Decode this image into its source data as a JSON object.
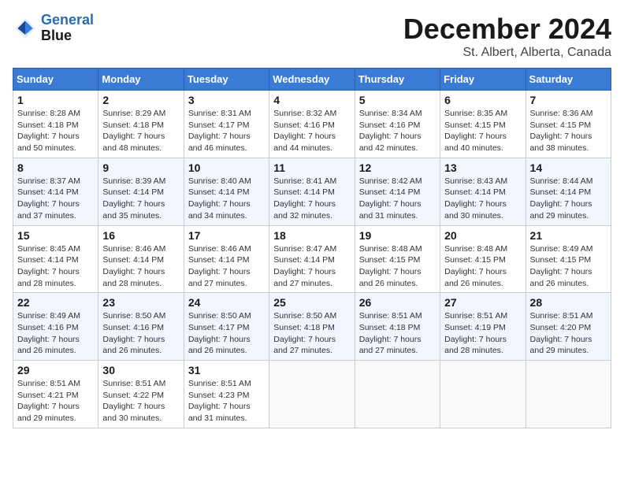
{
  "header": {
    "logo_line1": "General",
    "logo_line2": "Blue",
    "title": "December 2024",
    "subtitle": "St. Albert, Alberta, Canada"
  },
  "days_of_week": [
    "Sunday",
    "Monday",
    "Tuesday",
    "Wednesday",
    "Thursday",
    "Friday",
    "Saturday"
  ],
  "weeks": [
    [
      {
        "day": "1",
        "sunrise": "Sunrise: 8:28 AM",
        "sunset": "Sunset: 4:18 PM",
        "daylight": "Daylight: 7 hours and 50 minutes."
      },
      {
        "day": "2",
        "sunrise": "Sunrise: 8:29 AM",
        "sunset": "Sunset: 4:18 PM",
        "daylight": "Daylight: 7 hours and 48 minutes."
      },
      {
        "day": "3",
        "sunrise": "Sunrise: 8:31 AM",
        "sunset": "Sunset: 4:17 PM",
        "daylight": "Daylight: 7 hours and 46 minutes."
      },
      {
        "day": "4",
        "sunrise": "Sunrise: 8:32 AM",
        "sunset": "Sunset: 4:16 PM",
        "daylight": "Daylight: 7 hours and 44 minutes."
      },
      {
        "day": "5",
        "sunrise": "Sunrise: 8:34 AM",
        "sunset": "Sunset: 4:16 PM",
        "daylight": "Daylight: 7 hours and 42 minutes."
      },
      {
        "day": "6",
        "sunrise": "Sunrise: 8:35 AM",
        "sunset": "Sunset: 4:15 PM",
        "daylight": "Daylight: 7 hours and 40 minutes."
      },
      {
        "day": "7",
        "sunrise": "Sunrise: 8:36 AM",
        "sunset": "Sunset: 4:15 PM",
        "daylight": "Daylight: 7 hours and 38 minutes."
      }
    ],
    [
      {
        "day": "8",
        "sunrise": "Sunrise: 8:37 AM",
        "sunset": "Sunset: 4:14 PM",
        "daylight": "Daylight: 7 hours and 37 minutes."
      },
      {
        "day": "9",
        "sunrise": "Sunrise: 8:39 AM",
        "sunset": "Sunset: 4:14 PM",
        "daylight": "Daylight: 7 hours and 35 minutes."
      },
      {
        "day": "10",
        "sunrise": "Sunrise: 8:40 AM",
        "sunset": "Sunset: 4:14 PM",
        "daylight": "Daylight: 7 hours and 34 minutes."
      },
      {
        "day": "11",
        "sunrise": "Sunrise: 8:41 AM",
        "sunset": "Sunset: 4:14 PM",
        "daylight": "Daylight: 7 hours and 32 minutes."
      },
      {
        "day": "12",
        "sunrise": "Sunrise: 8:42 AM",
        "sunset": "Sunset: 4:14 PM",
        "daylight": "Daylight: 7 hours and 31 minutes."
      },
      {
        "day": "13",
        "sunrise": "Sunrise: 8:43 AM",
        "sunset": "Sunset: 4:14 PM",
        "daylight": "Daylight: 7 hours and 30 minutes."
      },
      {
        "day": "14",
        "sunrise": "Sunrise: 8:44 AM",
        "sunset": "Sunset: 4:14 PM",
        "daylight": "Daylight: 7 hours and 29 minutes."
      }
    ],
    [
      {
        "day": "15",
        "sunrise": "Sunrise: 8:45 AM",
        "sunset": "Sunset: 4:14 PM",
        "daylight": "Daylight: 7 hours and 28 minutes."
      },
      {
        "day": "16",
        "sunrise": "Sunrise: 8:46 AM",
        "sunset": "Sunset: 4:14 PM",
        "daylight": "Daylight: 7 hours and 28 minutes."
      },
      {
        "day": "17",
        "sunrise": "Sunrise: 8:46 AM",
        "sunset": "Sunset: 4:14 PM",
        "daylight": "Daylight: 7 hours and 27 minutes."
      },
      {
        "day": "18",
        "sunrise": "Sunrise: 8:47 AM",
        "sunset": "Sunset: 4:14 PM",
        "daylight": "Daylight: 7 hours and 27 minutes."
      },
      {
        "day": "19",
        "sunrise": "Sunrise: 8:48 AM",
        "sunset": "Sunset: 4:15 PM",
        "daylight": "Daylight: 7 hours and 26 minutes."
      },
      {
        "day": "20",
        "sunrise": "Sunrise: 8:48 AM",
        "sunset": "Sunset: 4:15 PM",
        "daylight": "Daylight: 7 hours and 26 minutes."
      },
      {
        "day": "21",
        "sunrise": "Sunrise: 8:49 AM",
        "sunset": "Sunset: 4:15 PM",
        "daylight": "Daylight: 7 hours and 26 minutes."
      }
    ],
    [
      {
        "day": "22",
        "sunrise": "Sunrise: 8:49 AM",
        "sunset": "Sunset: 4:16 PM",
        "daylight": "Daylight: 7 hours and 26 minutes."
      },
      {
        "day": "23",
        "sunrise": "Sunrise: 8:50 AM",
        "sunset": "Sunset: 4:16 PM",
        "daylight": "Daylight: 7 hours and 26 minutes."
      },
      {
        "day": "24",
        "sunrise": "Sunrise: 8:50 AM",
        "sunset": "Sunset: 4:17 PM",
        "daylight": "Daylight: 7 hours and 26 minutes."
      },
      {
        "day": "25",
        "sunrise": "Sunrise: 8:50 AM",
        "sunset": "Sunset: 4:18 PM",
        "daylight": "Daylight: 7 hours and 27 minutes."
      },
      {
        "day": "26",
        "sunrise": "Sunrise: 8:51 AM",
        "sunset": "Sunset: 4:18 PM",
        "daylight": "Daylight: 7 hours and 27 minutes."
      },
      {
        "day": "27",
        "sunrise": "Sunrise: 8:51 AM",
        "sunset": "Sunset: 4:19 PM",
        "daylight": "Daylight: 7 hours and 28 minutes."
      },
      {
        "day": "28",
        "sunrise": "Sunrise: 8:51 AM",
        "sunset": "Sunset: 4:20 PM",
        "daylight": "Daylight: 7 hours and 29 minutes."
      }
    ],
    [
      {
        "day": "29",
        "sunrise": "Sunrise: 8:51 AM",
        "sunset": "Sunset: 4:21 PM",
        "daylight": "Daylight: 7 hours and 29 minutes."
      },
      {
        "day": "30",
        "sunrise": "Sunrise: 8:51 AM",
        "sunset": "Sunset: 4:22 PM",
        "daylight": "Daylight: 7 hours and 30 minutes."
      },
      {
        "day": "31",
        "sunrise": "Sunrise: 8:51 AM",
        "sunset": "Sunset: 4:23 PM",
        "daylight": "Daylight: 7 hours and 31 minutes."
      },
      null,
      null,
      null,
      null
    ]
  ]
}
